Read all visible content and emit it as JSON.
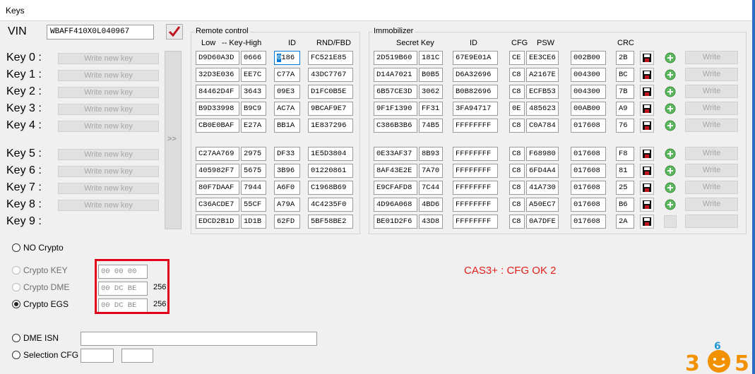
{
  "window": {
    "title": "Keys"
  },
  "vin": {
    "label": "VIN",
    "value": "WBAFF410X0L040967"
  },
  "keys": [
    {
      "label": "Key 0 :",
      "button": "Write new key"
    },
    {
      "label": "Key 1 :",
      "button": "Write new key"
    },
    {
      "label": "Key 2 :",
      "button": "Write new key"
    },
    {
      "label": "Key 3 :",
      "button": "Write new key"
    },
    {
      "label": "Key 4 :",
      "button": "Write new key"
    },
    {
      "label": "Key 5 :",
      "button": "Write new key"
    },
    {
      "label": "Key 6 :",
      "button": "Write new key"
    },
    {
      "label": "Key 7 :",
      "button": "Write new key"
    },
    {
      "label": "Key 8 :",
      "button": "Write new key"
    },
    {
      "label": "Key 9 :",
      "button": ""
    }
  ],
  "transfer_button": ">>",
  "remote": {
    "title": "Remote control",
    "headers": {
      "low": "Low",
      "key": "-- Key",
      "high": "-High",
      "id": "ID",
      "rnd": "RND/FBD"
    },
    "rows": [
      [
        "D9D60A3D",
        "0666",
        "0186",
        "FC521E85"
      ],
      [
        "32D3E036",
        "EE7C",
        "C77A",
        "43DC7767"
      ],
      [
        "84462D4F",
        "3643",
        "09E3",
        "D1FC0B5E"
      ],
      [
        "B9D33998",
        "B9C9",
        "AC7A",
        "9BCAF9E7"
      ],
      [
        "CB0E0BAF",
        "E27A",
        "BB1A",
        "1E837296"
      ],
      [
        "C27AA769",
        "2975",
        "DF33",
        "1E5D3804"
      ],
      [
        "405982F7",
        "5675",
        "3B96",
        "01220861"
      ],
      [
        "80F7DAAF",
        "7944",
        "A6F0",
        "C1968B69"
      ],
      [
        "C36ACDE7",
        "55CF",
        "A79A",
        "4C4235F0"
      ],
      [
        "EDCD2B1D",
        "1D1B",
        "62FD",
        "5BF58BE2"
      ]
    ]
  },
  "immo": {
    "title": "Immobilizer",
    "headers": {
      "secret": "Secret Key",
      "id": "ID",
      "cfg": "CFG",
      "psw": "PSW",
      "crc": "CRC"
    },
    "write_label": "Write",
    "rows": [
      [
        "2D519B60",
        "181C",
        "67E9E01A",
        "CE",
        "EE3CE6",
        "002B00",
        "2B"
      ],
      [
        "D14A7021",
        "B0B5",
        "D6A32696",
        "C8",
        "A2167E",
        "004300",
        "BC"
      ],
      [
        "6B57CE3D",
        "3062",
        "B0B82696",
        "C8",
        "ECFB53",
        "004300",
        "7B"
      ],
      [
        "9F1F1390",
        "FF31",
        "3FA94717",
        "0E",
        "485623",
        "00AB00",
        "A9"
      ],
      [
        "C386B3B6",
        "74B5",
        "FFFFFFFF",
        "C8",
        "C0A784",
        "017608",
        "76"
      ],
      [
        "0E33AF37",
        "8B93",
        "FFFFFFFF",
        "C8",
        "F68980",
        "017608",
        "F8"
      ],
      [
        "8AF43E2E",
        "7A70",
        "FFFFFFFF",
        "C8",
        "6FD4A4",
        "017608",
        "81"
      ],
      [
        "E9CFAFD8",
        "7C44",
        "FFFFFFFF",
        "C8",
        "41A730",
        "017608",
        "25"
      ],
      [
        "4D96A068",
        "4BD6",
        "FFFFFFFF",
        "C8",
        "A50EC7",
        "017608",
        "B6"
      ],
      [
        "BE01D2F6",
        "43D8",
        "FFFFFFFF",
        "C8",
        "0A7DFE",
        "017608",
        "2A"
      ]
    ]
  },
  "crypto": {
    "no_crypto": "NO Crypto",
    "key_label": "Crypto KEY",
    "key_value": "00 00 00",
    "dme_label": "Crypto DME",
    "dme_value": "00 DC BE",
    "dme_num": "256",
    "egs_label": "Crypto EGS",
    "egs_value": "00 DC BE",
    "egs_num": "256"
  },
  "status": {
    "text": "CAS3+ : CFG OK 2",
    "color": "#e0201b"
  },
  "dme_isn": {
    "label": "DME ISN",
    "value": ""
  },
  "selection_cfg": {
    "label": "Selection CFG",
    "value1": "",
    "value2": ""
  },
  "watermark": {
    "text": "305"
  },
  "colors": {
    "highlight_box": "#e2001a",
    "accent": "#0078d7"
  }
}
